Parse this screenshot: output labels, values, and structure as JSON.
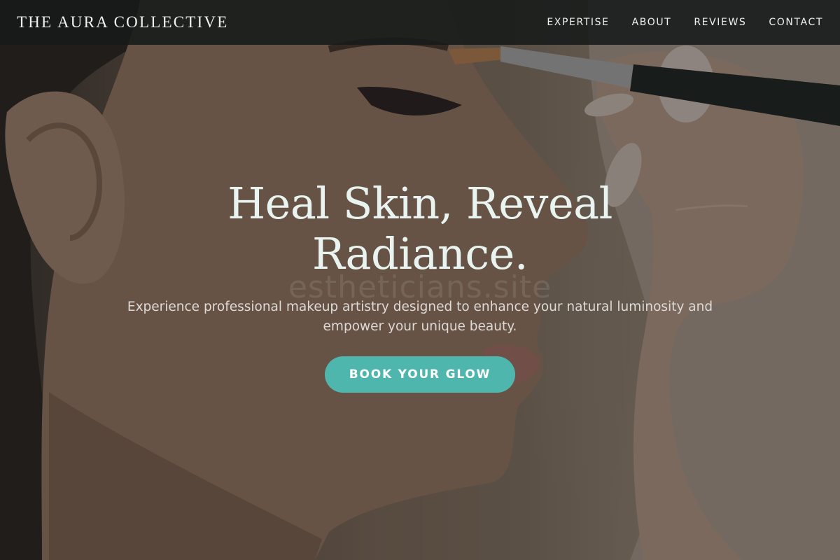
{
  "header": {
    "brand": "THE AURA COLLECTIVE",
    "nav": [
      "EXPERTISE",
      "ABOUT",
      "REVIEWS",
      "CONTACT"
    ]
  },
  "hero": {
    "headline": "Heal Skin, Reveal Radiance.",
    "watermark": "estheticians.site",
    "subtext": "Experience professional makeup artistry designed to enhance your natural luminosity and empower your unique beauty.",
    "cta": "BOOK YOUR GLOW"
  },
  "colors": {
    "accent": "#4fb6ad",
    "header_bg": "#161a19",
    "headline": "#e9f3f0"
  }
}
